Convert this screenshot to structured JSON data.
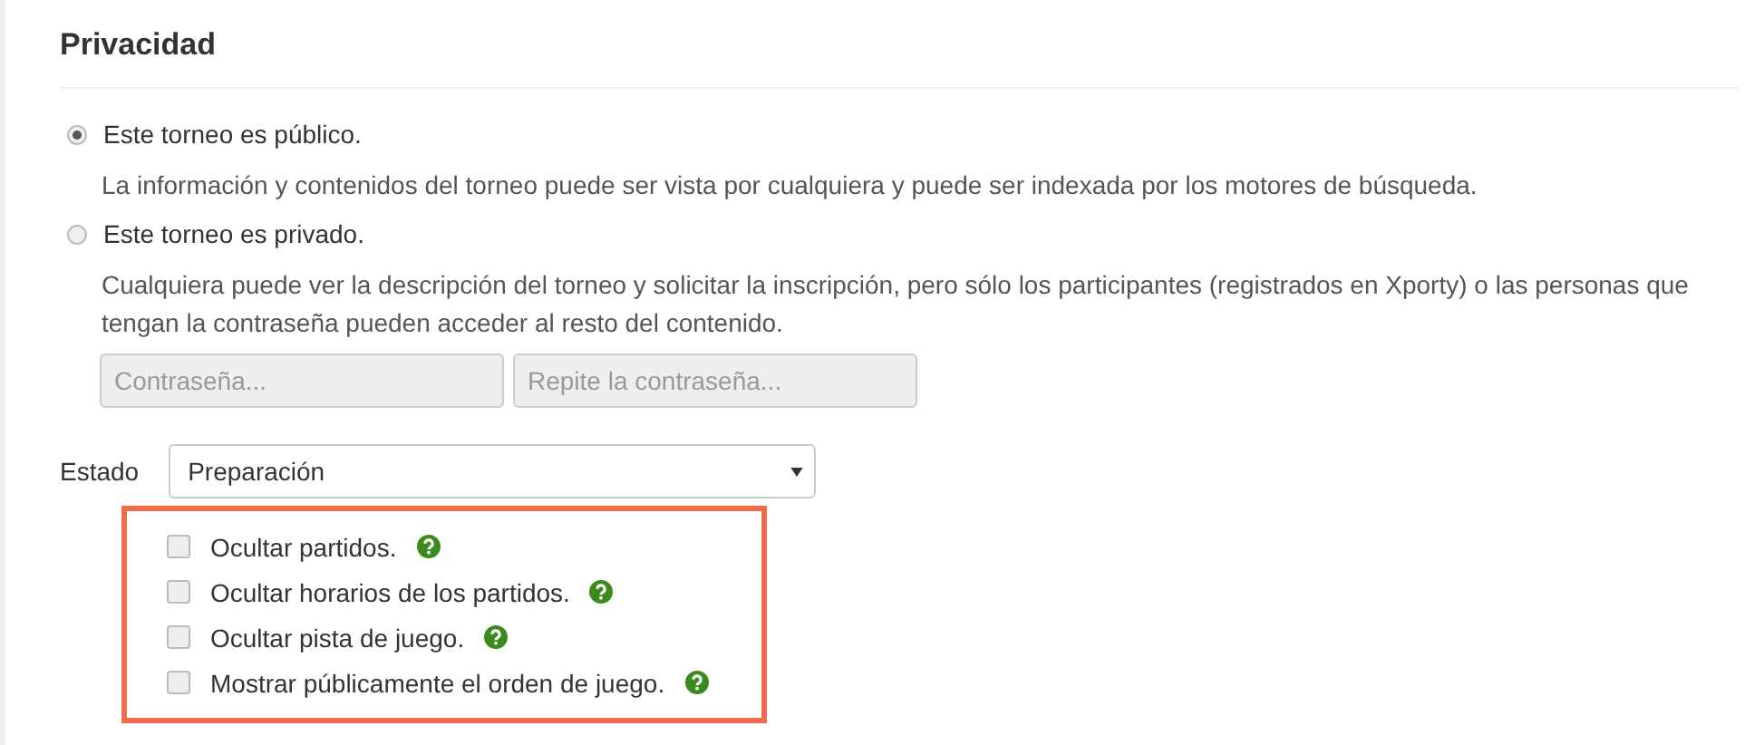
{
  "section": {
    "title": "Privacidad"
  },
  "visibility": [
    {
      "label": "Este torneo es público.",
      "selected": true,
      "description": "La información y contenidos del torneo puede ser vista por cualquiera y puede ser indexada por los motores de búsqueda."
    },
    {
      "label": "Este torneo es privado.",
      "selected": false,
      "description": "Cualquiera puede ver la descripción del torneo y solicitar la inscripción, pero sólo los participantes (registrados en Xporty) o las personas que tengan la contraseña pueden acceder al resto del contenido."
    }
  ],
  "password_fields": [
    {
      "placeholder": "Contraseña...",
      "disabled": true
    },
    {
      "placeholder": "Repite la contraseña...",
      "disabled": true
    }
  ],
  "status": {
    "label": "Estado",
    "value": "Preparación"
  },
  "options": [
    {
      "label": "Ocultar partidos.",
      "checked": false
    },
    {
      "label": "Ocultar horarios de los partidos.",
      "checked": false
    },
    {
      "label": "Ocultar pista de juego.",
      "checked": false
    },
    {
      "label": "Mostrar públicamente el orden de juego.",
      "checked": false
    }
  ]
}
